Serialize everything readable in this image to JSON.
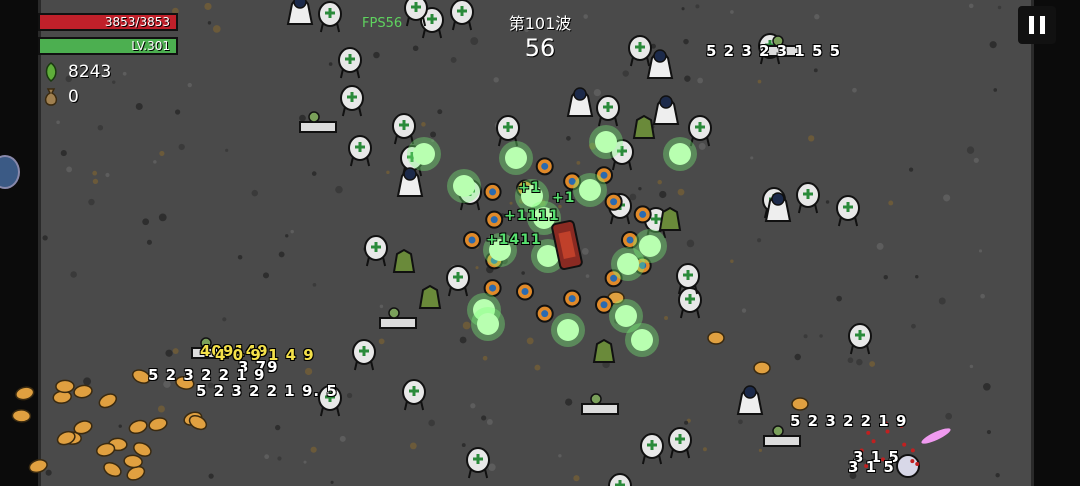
{
  "hud": {
    "hp_text": "3853/3853",
    "hp_fraction": 1.0,
    "level_text": "LV.301",
    "xp_fraction": 1.0,
    "gems": "8243",
    "bags": "0",
    "fps": "FPS56",
    "wave": "第101波",
    "timer": "56",
    "colors": {
      "hp": "#c0202a",
      "xp": "#4caf50",
      "arena": "#4a4a4a"
    },
    "icons": {
      "gem": "green-gem-icon",
      "bag": "money-bag-icon",
      "pause": "pause-icon"
    }
  },
  "damage_numbers": [
    {
      "text": "5 2 3 2 3 1 5 5",
      "color": "white"
    },
    {
      "text": "409149",
      "color": "yellow"
    },
    {
      "text": "4 0 9 1 4 9",
      "color": "yellow"
    },
    {
      "text": "3 79",
      "color": "white"
    },
    {
      "text": "5 2 3 2 2 1 9",
      "color": "white"
    },
    {
      "text": "5 2 3 2 2 1 9. 5",
      "color": "white"
    },
    {
      "text": "5 2 3 2 2 1 9",
      "color": "white"
    },
    {
      "text": "3 1 5",
      "color": "white"
    },
    {
      "text": "3 1 5",
      "color": "white"
    },
    {
      "text": "+1",
      "color": "green"
    },
    {
      "text": "+1",
      "color": "green"
    },
    {
      "text": "+1111",
      "color": "green"
    },
    {
      "text": "+1411",
      "color": "green"
    }
  ]
}
